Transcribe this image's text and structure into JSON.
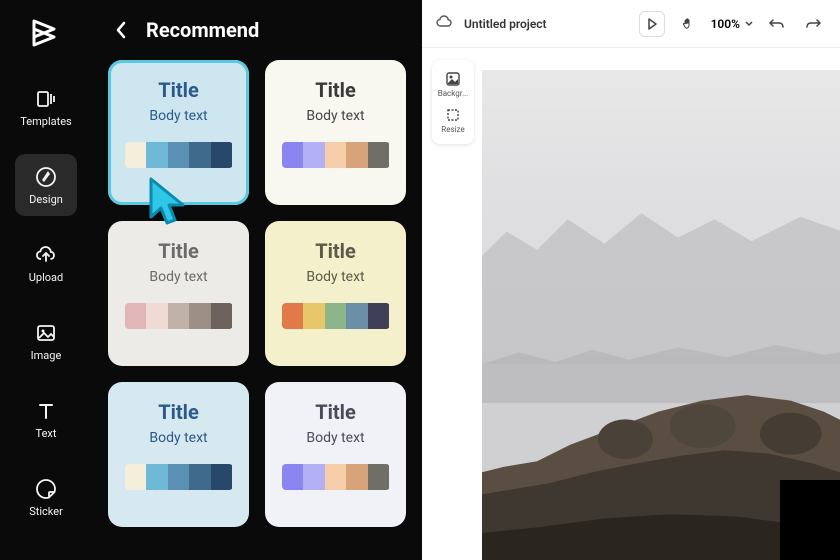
{
  "rail": {
    "items": [
      {
        "name": "templates",
        "label": "Templates"
      },
      {
        "name": "design",
        "label": "Design",
        "active": true
      },
      {
        "name": "upload",
        "label": "Upload"
      },
      {
        "name": "image",
        "label": "Image"
      },
      {
        "name": "text",
        "label": "Text"
      },
      {
        "name": "sticker",
        "label": "Sticker"
      }
    ]
  },
  "panel": {
    "title": "Recommend",
    "cards": [
      {
        "title": "Title",
        "body": "Body text",
        "bg": "#cde6f0",
        "title_color": "#2a5a8a",
        "body_color": "#2a5a8a",
        "selected": true,
        "swatches": [
          "#f5eeda",
          "#6fb9d6",
          "#5a90b4",
          "#3f6a8c",
          "#27486a"
        ]
      },
      {
        "title": "Title",
        "body": "Body text",
        "bg": "#f8f7f0",
        "title_color": "#3a3a3a",
        "body_color": "#444",
        "selected": false,
        "swatches": [
          "#8a85f0",
          "#b3b0f5",
          "#f5cda8",
          "#d6a37a",
          "#6f6f66"
        ]
      },
      {
        "title": "Title",
        "body": "Body text",
        "bg": "#ecebe8",
        "title_color": "#6a6a6a",
        "body_color": "#6a6a6a",
        "selected": false,
        "swatches": [
          "#e0b6b8",
          "#f0dad6",
          "#c0b2a8",
          "#9c8f85",
          "#6e635c"
        ]
      },
      {
        "title": "Title",
        "body": "Body text",
        "bg": "#f4f0cc",
        "title_color": "#5a5a48",
        "body_color": "#5a5a48",
        "selected": false,
        "swatches": [
          "#e07a4a",
          "#e8c76a",
          "#8cb58a",
          "#6a8fa6",
          "#3f3f58"
        ]
      },
      {
        "title": "Title",
        "body": "Body text",
        "bg": "#d6e8f0",
        "title_color": "#2a5a8a",
        "body_color": "#2a5a8a",
        "selected": false,
        "swatches": [
          "#f5eeda",
          "#6fb9d6",
          "#5a90b4",
          "#3f6a8c",
          "#27486a"
        ]
      },
      {
        "title": "Title",
        "body": "Body text",
        "bg": "#f0f2f8",
        "title_color": "#4a4a5a",
        "body_color": "#4a4a5a",
        "selected": false,
        "swatches": [
          "#8a85f0",
          "#b3b0f5",
          "#f5cda8",
          "#d6a37a",
          "#6f6f66"
        ]
      }
    ]
  },
  "topbar": {
    "project_title": "Untitled project",
    "zoom": "100%",
    "tools": {
      "background": "Backgr...",
      "resize": "Resize"
    }
  }
}
